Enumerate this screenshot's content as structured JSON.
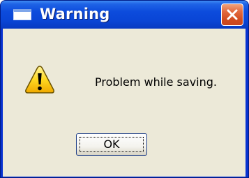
{
  "window": {
    "title": "Warning",
    "title_icon": "window-icon",
    "close_icon": "close-x-icon",
    "colors": {
      "titlebar": "#0a46d6",
      "close_button": "#d14b1e",
      "client": "#ece9d8"
    }
  },
  "dialog": {
    "icon": "warning-triangle-icon",
    "message": "Problem while saving."
  },
  "buttons": {
    "ok_label": "OK"
  }
}
